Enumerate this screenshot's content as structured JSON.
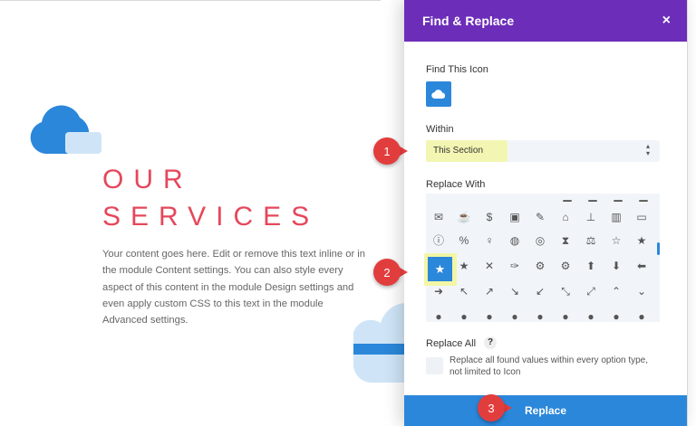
{
  "page": {
    "heading_line1": "OUR",
    "heading_line2": "SERVICES",
    "body_text": "Your content goes here. Edit or remove this text inline or in the module Content settings. You can also style every aspect of this content in the module Design settings and even apply custom CSS to this text in the module Advanced settings."
  },
  "modal": {
    "title": "Find & Replace",
    "close_symbol": "×",
    "find_label": "Find This Icon",
    "find_icon": "cloud-icon",
    "within_label": "Within",
    "within_value": "This Section",
    "replace_with_label": "Replace With",
    "replace_all_label": "Replace All",
    "help_symbol": "?",
    "replace_all_description": "Replace all found values within every option type, not limited to Icon",
    "replace_button": "Replace",
    "selected_icon": "star-icon"
  },
  "callouts": [
    "1",
    "2",
    "3"
  ],
  "colors": {
    "header_purple": "#6c2eb9",
    "accent_blue": "#2b87da",
    "heading_red": "#e5475b",
    "callout_red": "#e23d3d",
    "highlight_yellow": "#f3f6a6"
  },
  "icon_grid": {
    "rows": [
      [
        "envelope-icon",
        "mug-icon",
        "dollar-circle-icon",
        "wallet-icon",
        "pencils-icon",
        "presentation-icon",
        "org-chart-icon",
        "bar-chart-icon",
        "briefcase-icon"
      ],
      [
        "alert-circle-icon",
        "percent-circle-icon",
        "bulb-icon",
        "globe-icon",
        "target-icon",
        "hourglass-icon",
        "scales-icon",
        "star-outline-icon",
        "star-half-icon"
      ],
      [
        "star-filled-icon",
        "star-half-filled-icon",
        "tools-icon",
        "wrench-icon",
        "gear-icon",
        "gears-icon",
        "arrow-up-circle-icon",
        "arrow-down-circle-icon",
        "arrow-left-circle-icon"
      ],
      [
        "arrow-right-circle-icon",
        "arrow-up-left-circle-icon",
        "arrow-up-right-circle-icon",
        "arrow-down-right-circle-icon",
        "arrow-down-left-circle-icon",
        "collapse-icon",
        "expand-icon",
        "chevron-up-circle-icon",
        "chevron-down-circle-icon"
      ],
      [
        "chevron-left-circle-icon",
        "chevron-right-circle-icon",
        "chevron-up-left-icon",
        "chevron-up-right-icon",
        "chevrons-icon",
        "chevrons-alt-icon",
        "triangle-up-icon",
        "triangle-down-icon",
        "triangle-left-icon"
      ]
    ]
  }
}
